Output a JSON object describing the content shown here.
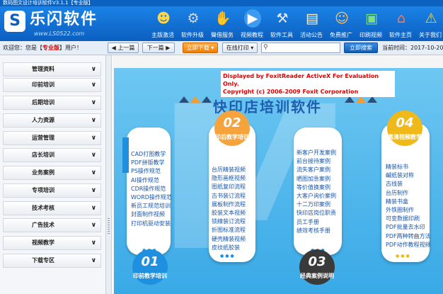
{
  "window": {
    "title": "数码图文设计培训软件V3.1.1【专业版】"
  },
  "header": {
    "logo_text": "乐闪软件",
    "logo_url": "www.LS0522.com",
    "tools": [
      {
        "label": "主版激活",
        "icon": "user-group-icon"
      },
      {
        "label": "软件升级",
        "icon": "gear-icon"
      },
      {
        "label": "聲借服务",
        "icon": "handshake-icon"
      },
      {
        "label": "视频教程",
        "icon": "play-icon"
      },
      {
        "label": "软件工具",
        "icon": "tools-icon"
      },
      {
        "label": "活动公告",
        "icon": "notice-icon"
      },
      {
        "label": "免费推广",
        "icon": "people-icon"
      },
      {
        "label": "印刷视频",
        "icon": "cubes-icon"
      },
      {
        "label": "软件主页",
        "icon": "home-icon"
      },
      {
        "label": "关于我们",
        "icon": "warning-icon"
      }
    ]
  },
  "statusbar": {
    "welcome_prefix": "欢迎您：您是【",
    "account_type": "专业版",
    "welcome_suffix": "】用户！",
    "prev_label": "上一篇",
    "next_label": "下一篇",
    "download_label": "立即下载",
    "print_label": "在线打印",
    "search_value": "",
    "search_button": "立即搜索",
    "current_time": "当前时间：2017-10-20 23:03"
  },
  "sidebar": {
    "items": [
      {
        "label": "管理资料"
      },
      {
        "label": "印前培训"
      },
      {
        "label": "后期培训"
      },
      {
        "label": "人力资源"
      },
      {
        "label": "运营管理"
      },
      {
        "label": "店长培训"
      },
      {
        "label": "业务案例"
      },
      {
        "label": "专项培训"
      },
      {
        "label": "技术考核"
      },
      {
        "label": "广告技术"
      },
      {
        "label": "视频教学"
      },
      {
        "label": "下载专区"
      }
    ]
  },
  "content": {
    "watermark_line1": "Displayed by FoxitReader ActiveX For Evaluation Only.",
    "watermark_line2": "Copyright (c) 2006-2009 Foxit Corporation",
    "banner_title": "快印店培训软件",
    "cards": [
      {
        "number": "01",
        "title": "印前教学培训",
        "color": "#1f8fe0",
        "items": [
          "CAD打图教学",
          "PDF拼版教学",
          "PS操作规范",
          "AI操作规范",
          "CDR操作规范",
          "WORD操作规范",
          "新员工规范培训",
          "封面制作视频",
          "打印机驱动安装"
        ]
      },
      {
        "number": "02",
        "title": "印后教学培训",
        "color": "#f5a33a",
        "items": [
          "台历精装视频",
          "隐形画框视频",
          "图纸复印流程",
          "古书装订流程",
          "展板制作流程",
          "胶装文本视频",
          "锁線装订流程",
          "折图标准流程",
          "硬壳精装视频",
          "皮纹纸胶装"
        ]
      },
      {
        "number": "03",
        "title": "经典案例说明",
        "color": "#3a3a3a",
        "items": [
          "新客户开发案例",
          "前台接待案例",
          "流失客户案例",
          "晒图加急案例",
          "等价值换案例",
          "大客户询价案例",
          "十二万印案例",
          "快印店岗位职责",
          "员工手册",
          "绩效考核手册"
        ]
      },
      {
        "number": "04",
        "title": "高清视频教学",
        "color": "#f0b91a",
        "items": [
          "精装标书",
          "鹹纸装对称",
          "古线装",
          "台历制作",
          "精装书盒",
          "外铁圈制作",
          "可变数据印刷",
          "PDF批量去水印",
          "PDF两种转曲方法",
          "PDF动作教程视频"
        ]
      }
    ]
  }
}
